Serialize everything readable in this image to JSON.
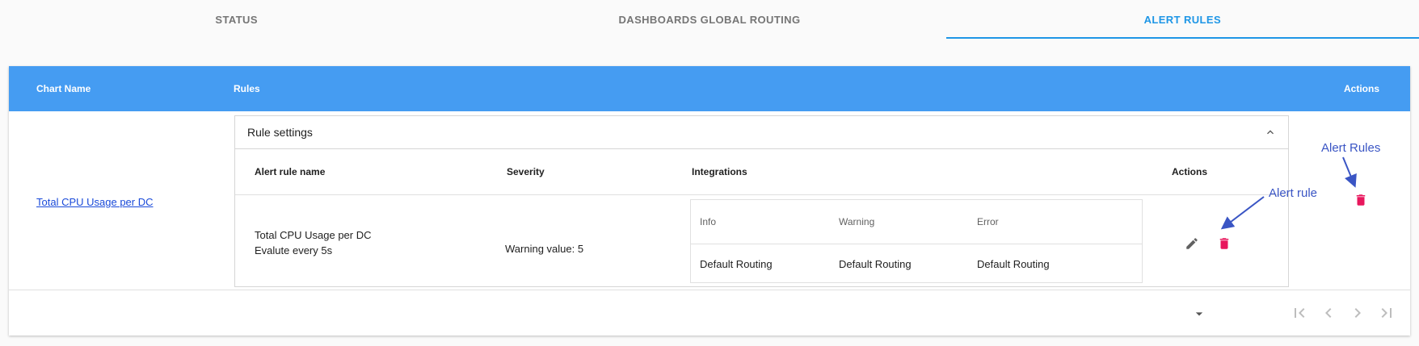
{
  "tabs": [
    {
      "label": "STATUS",
      "active": false
    },
    {
      "label": "DASHBOARDS GLOBAL ROUTING",
      "active": false
    },
    {
      "label": "ALERT RULES",
      "active": true
    }
  ],
  "table": {
    "headers": {
      "chart_name": "Chart Name",
      "rules": "Rules",
      "actions": "Actions"
    },
    "row": {
      "chart_name": "Total CPU Usage per DC",
      "rule_settings": {
        "title": "Rule settings",
        "headers": {
          "name": "Alert rule name",
          "severity": "Severity",
          "integrations": "Integrations",
          "actions": "Actions"
        },
        "rule": {
          "name_line1": "Total CPU Usage per DC",
          "name_line2": "Evalute every 5s",
          "severity": "Warning value: 5",
          "integrations": {
            "headers": [
              "Info",
              "Warning",
              "Error"
            ],
            "values": [
              "Default Routing",
              "Default Routing",
              "Default Routing"
            ]
          }
        }
      }
    }
  },
  "annotations": {
    "alert_rules": "Alert Rules",
    "alert_rule": "Alert rule"
  },
  "colors": {
    "accent": "#1e96e6",
    "header": "#459cf2",
    "delete": "#e8175d",
    "annotation": "#3a55c4"
  },
  "icons": [
    "chevron-up-icon",
    "edit-icon",
    "delete-icon",
    "arrow-drop-down-icon",
    "first-page-icon",
    "prev-page-icon",
    "next-page-icon",
    "last-page-icon"
  ]
}
